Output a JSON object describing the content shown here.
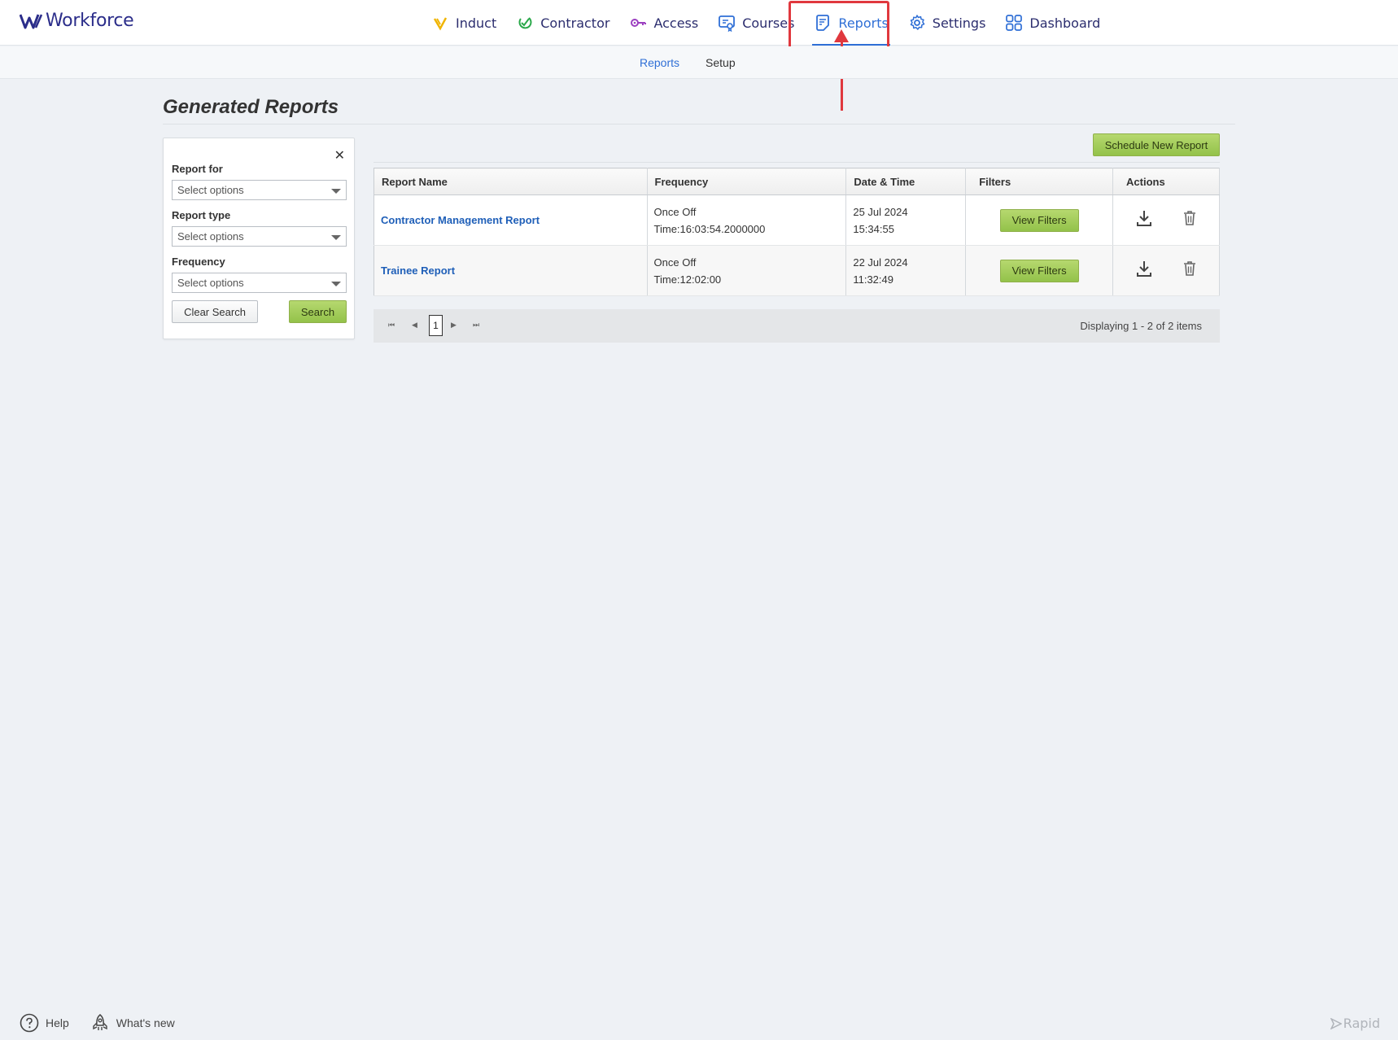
{
  "app": {
    "name": "Workforce"
  },
  "nav": {
    "induct": "Induct",
    "contractor": "Contractor",
    "access": "Access",
    "courses": "Courses",
    "reports": "Reports",
    "settings": "Settings",
    "dashboard": "Dashboard",
    "active": "reports"
  },
  "subnav": {
    "reports": "Reports",
    "setup": "Setup",
    "active": "reports"
  },
  "page": {
    "title": "Generated Reports"
  },
  "filter": {
    "close": "✕",
    "report_for_label": "Report for",
    "report_for_placeholder": "Select options",
    "report_type_label": "Report type",
    "report_type_placeholder": "Select options",
    "frequency_label": "Frequency",
    "frequency_placeholder": "Select options",
    "clear_label": "Clear Search",
    "search_label": "Search"
  },
  "toolbar": {
    "schedule_label": "Schedule New Report"
  },
  "grid": {
    "columns": [
      "Report Name",
      "Frequency",
      "Date & Time",
      "Filters",
      "Actions"
    ],
    "rows": [
      {
        "name": "Contractor Management Report",
        "frequency": "Once Off",
        "time": "Time:16:03:54.2000000",
        "date": "25 Jul 2024",
        "clock": "15:34:55",
        "filters": "View Filters"
      },
      {
        "name": "Trainee Report",
        "frequency": "Once Off",
        "time": "Time:12:02:00",
        "date": "22 Jul 2024",
        "clock": "11:32:49",
        "filters": "View Filters"
      }
    ]
  },
  "pager": {
    "current_page": "1",
    "info": "Displaying 1 - 2 of 2 items",
    "first": "⏮",
    "prev": "◀",
    "next": "▶",
    "last": "⏭"
  },
  "footer": {
    "help": "Help",
    "whats_new": "What's new",
    "brand": "Rapid"
  },
  "colors": {
    "accent": "#2f6fd6",
    "green_button": "#93c24a",
    "annotation": "#e0383e",
    "link": "#1f5fb8"
  }
}
